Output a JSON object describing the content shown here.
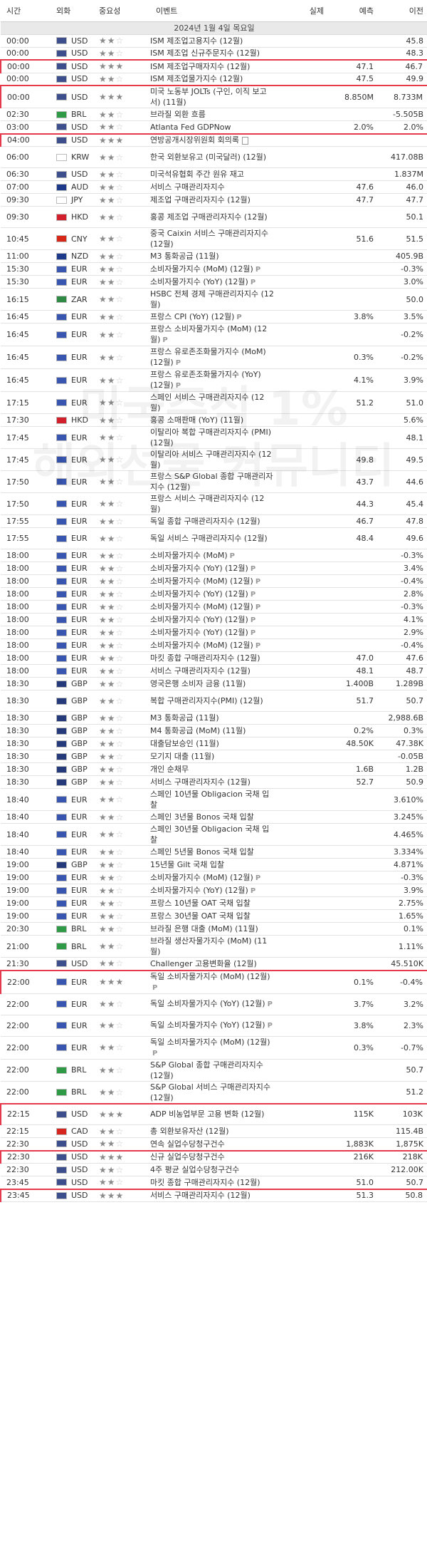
{
  "header": {
    "time": "시간",
    "currency": "외화",
    "importance": "중요성",
    "event": "이벤트",
    "actual": "실제",
    "forecast": "예측",
    "previous": "이전"
  },
  "date_label": "2024년 1월 4일 목요일",
  "watermark": [
    "미국주식 1%",
    "해외선물 커뮤니티"
  ],
  "colors": {
    "highlight_border": "#e53a4b",
    "date_bg": "#e9e9e9",
    "star_on": "#8a8a8a",
    "star_off": "#c8c8c8"
  },
  "icons": {
    "preliminary": "P",
    "speech": "document-icon",
    "importance": "star-icon"
  },
  "flag_colors": {
    "USD": "#3c4f8c",
    "BRL": "#2f9a45",
    "KRW": "#ffffff",
    "AUD": "#1d3a8a",
    "JPY": "#ffffff",
    "HKD": "#d21f2c",
    "CNY": "#d62718",
    "NZD": "#1d3a8a",
    "EUR": "#3856b0",
    "ZAR": "#2f8a45",
    "GBP": "#243a7a",
    "CAD": "#d6241e"
  },
  "events": [
    {
      "time": "00:00",
      "cur": "USD",
      "imp": 2,
      "name": "ISM 제조업고용지수 (12월)",
      "act": "",
      "fc": "",
      "prev": "45.8",
      "h": 18
    },
    {
      "time": "00:00",
      "cur": "USD",
      "imp": 2,
      "name": "ISM 제조업 신규주문지수 (12월)",
      "act": "",
      "fc": "",
      "prev": "48.3",
      "h": 18
    },
    {
      "time": "00:00",
      "cur": "USD",
      "imp": 3,
      "name": "ISM 제조업구매자지수 (12월)",
      "act": "",
      "fc": "47.1",
      "prev": "46.7",
      "h": 18,
      "hl": 1
    },
    {
      "time": "00:00",
      "cur": "USD",
      "imp": 2,
      "name": "ISM 제조업물가지수 (12월)",
      "act": "",
      "fc": "47.5",
      "prev": "49.9",
      "h": 18
    },
    {
      "time": "00:00",
      "cur": "USD",
      "imp": 3,
      "name": "미국 노동부 JOLTs (구인, 이직 보고서) (11월)",
      "act": "",
      "fc": "8.850M",
      "prev": "8.733M",
      "h": 30,
      "hl": 1
    },
    {
      "time": "02:30",
      "cur": "BRL",
      "imp": 2,
      "name": "브라질 외환 흐름",
      "act": "",
      "fc": "",
      "prev": "-5.505B",
      "h": 18
    },
    {
      "time": "03:00",
      "cur": "USD",
      "imp": 2,
      "name": "Atlanta Fed GDPNow",
      "act": "",
      "fc": "2.0%",
      "prev": "2.0%",
      "h": 18
    },
    {
      "time": "04:00",
      "cur": "USD",
      "imp": 3,
      "name": "연방공개시장위원회 회의록",
      "act": "",
      "fc": "",
      "prev": "",
      "h": 18,
      "hl": 1,
      "doc": 1
    },
    {
      "time": "06:00",
      "cur": "KRW",
      "imp": 2,
      "name": "한국 외환보유고 (미국달러) (12월)",
      "act": "",
      "fc": "",
      "prev": "417.08B",
      "h": 30
    },
    {
      "time": "06:30",
      "cur": "USD",
      "imp": 2,
      "name": "미국석유협회 주간 원유 재고",
      "act": "",
      "fc": "",
      "prev": "1.837M",
      "h": 18
    },
    {
      "time": "07:00",
      "cur": "AUD",
      "imp": 2,
      "name": "서비스 구매관리자지수",
      "act": "",
      "fc": "47.6",
      "prev": "46.0",
      "h": 18
    },
    {
      "time": "09:30",
      "cur": "JPY",
      "imp": 2,
      "name": "제조업 구매관리자지수 (12월)",
      "act": "",
      "fc": "47.7",
      "prev": "47.7",
      "h": 18
    },
    {
      "time": "09:30",
      "cur": "HKD",
      "imp": 2,
      "name": "홍콩 제조업 구매관리자지수 (12월)",
      "act": "",
      "fc": "",
      "prev": "50.1",
      "h": 30
    },
    {
      "time": "10:45",
      "cur": "CNY",
      "imp": 2,
      "name": "중국 Caixin 서비스 구매관리자지수 (12월)",
      "act": "",
      "fc": "51.6",
      "prev": "51.5",
      "h": 30
    },
    {
      "time": "11:00",
      "cur": "NZD",
      "imp": 2,
      "name": "M3 통화공급 (11월)",
      "act": "",
      "fc": "",
      "prev": "405.9B",
      "h": 18
    },
    {
      "time": "15:30",
      "cur": "EUR",
      "imp": 2,
      "name": "소비자물가지수 (MoM) (12월)",
      "act": "",
      "fc": "",
      "prev": "-0.3%",
      "h": 18,
      "p": 1
    },
    {
      "time": "15:30",
      "cur": "EUR",
      "imp": 2,
      "name": "소비자물가지수 (YoY) (12월)",
      "act": "",
      "fc": "",
      "prev": "3.0%",
      "h": 18,
      "p": 1
    },
    {
      "time": "16:15",
      "cur": "ZAR",
      "imp": 2,
      "name": "HSBC 전체 경제 구매관리자지수 (12월)",
      "act": "",
      "fc": "",
      "prev": "50.0",
      "h": 30
    },
    {
      "time": "16:45",
      "cur": "EUR",
      "imp": 2,
      "name": "프랑스 CPI (YoY) (12월)",
      "act": "",
      "fc": "3.8%",
      "prev": "3.5%",
      "h": 18,
      "p": 1
    },
    {
      "time": "16:45",
      "cur": "EUR",
      "imp": 2,
      "name": "프랑스 소비자물가지수 (MoM) (12월)",
      "act": "",
      "fc": "",
      "prev": "-0.2%",
      "h": 30,
      "p": 1
    },
    {
      "time": "16:45",
      "cur": "EUR",
      "imp": 2,
      "name": "프랑스 유로존조화물가지수 (MoM) (12월)",
      "act": "",
      "fc": "0.3%",
      "prev": "-0.2%",
      "h": 30,
      "p": 1
    },
    {
      "time": "16:45",
      "cur": "EUR",
      "imp": 2,
      "name": "프랑스 유로존조화물가지수 (YoY) (12월)",
      "act": "",
      "fc": "4.1%",
      "prev": "3.9%",
      "h": 30,
      "p": 1
    },
    {
      "time": "17:15",
      "cur": "EUR",
      "imp": 2,
      "name": "스페인 서비스 구매관리자지수 (12월)",
      "act": "",
      "fc": "51.2",
      "prev": "51.0",
      "h": 30
    },
    {
      "time": "17:30",
      "cur": "HKD",
      "imp": 2,
      "name": "홍콩 소매판매 (YoY) (11월)",
      "act": "",
      "fc": "",
      "prev": "5.6%",
      "h": 18
    },
    {
      "time": "17:45",
      "cur": "EUR",
      "imp": 2,
      "name": "이탈리아 복합 구매관리자지수 (PMI) (12월)",
      "act": "",
      "fc": "",
      "prev": "48.1",
      "h": 30
    },
    {
      "time": "17:45",
      "cur": "EUR",
      "imp": 2,
      "name": "이탈리아 서비스 구매관리자지수 (12월)",
      "act": "",
      "fc": "49.8",
      "prev": "49.5",
      "h": 30
    },
    {
      "time": "17:50",
      "cur": "EUR",
      "imp": 2,
      "name": "프랑스 S&P Global 종합 구매관리자지수 (12월)",
      "act": "",
      "fc": "43.7",
      "prev": "44.6",
      "h": 30
    },
    {
      "time": "17:50",
      "cur": "EUR",
      "imp": 2,
      "name": "프랑스 서비스 구매관리자지수 (12월)",
      "act": "",
      "fc": "44.3",
      "prev": "45.4",
      "h": 30
    },
    {
      "time": "17:55",
      "cur": "EUR",
      "imp": 2,
      "name": "독일 종합 구매관리자지수 (12월)",
      "act": "",
      "fc": "46.7",
      "prev": "47.8",
      "h": 18
    },
    {
      "time": "17:55",
      "cur": "EUR",
      "imp": 2,
      "name": "독일 서비스 구매관리자지수 (12월)",
      "act": "",
      "fc": "48.4",
      "prev": "49.6",
      "h": 30
    },
    {
      "time": "18:00",
      "cur": "EUR",
      "imp": 2,
      "name": "소비자물가지수 (MoM)",
      "act": "",
      "fc": "",
      "prev": "-0.3%",
      "h": 18,
      "p": 1
    },
    {
      "time": "18:00",
      "cur": "EUR",
      "imp": 2,
      "name": "소비자물가지수 (YoY) (12월)",
      "act": "",
      "fc": "",
      "prev": "3.4%",
      "h": 18,
      "p": 1
    },
    {
      "time": "18:00",
      "cur": "EUR",
      "imp": 2,
      "name": "소비자물가지수 (MoM) (12월)",
      "act": "",
      "fc": "",
      "prev": "-0.4%",
      "h": 18,
      "p": 1
    },
    {
      "time": "18:00",
      "cur": "EUR",
      "imp": 2,
      "name": "소비자물가지수 (YoY) (12월)",
      "act": "",
      "fc": "",
      "prev": "2.8%",
      "h": 18,
      "p": 1
    },
    {
      "time": "18:00",
      "cur": "EUR",
      "imp": 2,
      "name": "소비자물가지수 (MoM) (12월)",
      "act": "",
      "fc": "",
      "prev": "-0.3%",
      "h": 18,
      "p": 1
    },
    {
      "time": "18:00",
      "cur": "EUR",
      "imp": 2,
      "name": "소비자물가지수 (YoY) (12월)",
      "act": "",
      "fc": "",
      "prev": "4.1%",
      "h": 18,
      "p": 1
    },
    {
      "time": "18:00",
      "cur": "EUR",
      "imp": 2,
      "name": "소비자물가지수 (YoY) (12월)",
      "act": "",
      "fc": "",
      "prev": "2.9%",
      "h": 18,
      "p": 1
    },
    {
      "time": "18:00",
      "cur": "EUR",
      "imp": 2,
      "name": "소비자물가지수 (MoM) (12월)",
      "act": "",
      "fc": "",
      "prev": "-0.4%",
      "h": 18,
      "p": 1
    },
    {
      "time": "18:00",
      "cur": "EUR",
      "imp": 2,
      "name": "마킷 종합 구매관리자지수 (12월)",
      "act": "",
      "fc": "47.0",
      "prev": "47.6",
      "h": 18
    },
    {
      "time": "18:00",
      "cur": "EUR",
      "imp": 2,
      "name": "서비스 구매관리자지수 (12월)",
      "act": "",
      "fc": "48.1",
      "prev": "48.7",
      "h": 18
    },
    {
      "time": "18:30",
      "cur": "GBP",
      "imp": 2,
      "name": "영국은행 소비자 금융 (11월)",
      "act": "",
      "fc": "1.400B",
      "prev": "1.289B",
      "h": 18
    },
    {
      "time": "18:30",
      "cur": "GBP",
      "imp": 2,
      "name": "복합 구매관리자지수(PMI) (12월)",
      "act": "",
      "fc": "51.7",
      "prev": "50.7",
      "h": 30
    },
    {
      "time": "18:30",
      "cur": "GBP",
      "imp": 2,
      "name": "M3 통화공급 (11월)",
      "act": "",
      "fc": "",
      "prev": "2,988.6B",
      "h": 18
    },
    {
      "time": "18:30",
      "cur": "GBP",
      "imp": 2,
      "name": "M4 통화공급 (MoM) (11월)",
      "act": "",
      "fc": "0.2%",
      "prev": "0.3%",
      "h": 18
    },
    {
      "time": "18:30",
      "cur": "GBP",
      "imp": 2,
      "name": "대출담보승인 (11월)",
      "act": "",
      "fc": "48.50K",
      "prev": "47.38K",
      "h": 18
    },
    {
      "time": "18:30",
      "cur": "GBP",
      "imp": 2,
      "name": "모기지 대출 (11월)",
      "act": "",
      "fc": "",
      "prev": "-0.05B",
      "h": 18
    },
    {
      "time": "18:30",
      "cur": "GBP",
      "imp": 2,
      "name": "개인 순채무",
      "act": "",
      "fc": "1.6B",
      "prev": "1.2B",
      "h": 18
    },
    {
      "time": "18:30",
      "cur": "GBP",
      "imp": 2,
      "name": "서비스 구매관리자지수 (12월)",
      "act": "",
      "fc": "52.7",
      "prev": "50.9",
      "h": 18
    },
    {
      "time": "18:40",
      "cur": "EUR",
      "imp": 2,
      "name": "스페인 10년물 Obligacion 국채 입찰",
      "act": "",
      "fc": "",
      "prev": "3.610%",
      "h": 30
    },
    {
      "time": "18:40",
      "cur": "EUR",
      "imp": 2,
      "name": "스페인 3년물 Bonos 국채 입찰",
      "act": "",
      "fc": "",
      "prev": "3.245%",
      "h": 18
    },
    {
      "time": "18:40",
      "cur": "EUR",
      "imp": 2,
      "name": "스페인 30년물 Obligacion 국채 입찰",
      "act": "",
      "fc": "",
      "prev": "4.465%",
      "h": 30
    },
    {
      "time": "18:40",
      "cur": "EUR",
      "imp": 2,
      "name": "스페인 5년물 Bonos 국채 입찰",
      "act": "",
      "fc": "",
      "prev": "3.334%",
      "h": 18
    },
    {
      "time": "19:00",
      "cur": "GBP",
      "imp": 2,
      "name": "15년물 Gilt 국채 입찰",
      "act": "",
      "fc": "",
      "prev": "4.871%",
      "h": 18
    },
    {
      "time": "19:00",
      "cur": "EUR",
      "imp": 2,
      "name": "소비자물가지수 (MoM) (12월)",
      "act": "",
      "fc": "",
      "prev": "-0.3%",
      "h": 18,
      "p": 1
    },
    {
      "time": "19:00",
      "cur": "EUR",
      "imp": 2,
      "name": "소비자물가지수 (YoY) (12월)",
      "act": "",
      "fc": "",
      "prev": "3.9%",
      "h": 18,
      "p": 1
    },
    {
      "time": "19:00",
      "cur": "EUR",
      "imp": 2,
      "name": "프랑스 10년물 OAT 국채 입찰",
      "act": "",
      "fc": "",
      "prev": "2.75%",
      "h": 18
    },
    {
      "time": "19:00",
      "cur": "EUR",
      "imp": 2,
      "name": "프랑스 30년물 OAT 국채 입찰",
      "act": "",
      "fc": "",
      "prev": "1.65%",
      "h": 18
    },
    {
      "time": "20:30",
      "cur": "BRL",
      "imp": 2,
      "name": "브라질 은행 대출 (MoM) (11월)",
      "act": "",
      "fc": "",
      "prev": "0.1%",
      "h": 18
    },
    {
      "time": "21:00",
      "cur": "BRL",
      "imp": 2,
      "name": "브라질 생산자물가지수 (MoM) (11월)",
      "act": "",
      "fc": "",
      "prev": "1.11%",
      "h": 30
    },
    {
      "time": "21:30",
      "cur": "USD",
      "imp": 2,
      "name": "Challenger 고용변화율 (12월)",
      "act": "",
      "fc": "",
      "prev": "45.510K",
      "h": 18
    },
    {
      "time": "22:00",
      "cur": "EUR",
      "imp": 3,
      "name": "독일 소비자물가지수 (MoM) (12월)",
      "act": "",
      "fc": "0.1%",
      "prev": "-0.4%",
      "h": 30,
      "hl": 1,
      "p": 1
    },
    {
      "time": "22:00",
      "cur": "EUR",
      "imp": 2,
      "name": "독일 소비자물가지수 (YoY) (12월)",
      "act": "",
      "fc": "3.7%",
      "prev": "3.2%",
      "h": 30,
      "p": 1
    },
    {
      "time": "22:00",
      "cur": "EUR",
      "imp": 2,
      "name": "독일 소비자물가지수 (YoY) (12월)",
      "act": "",
      "fc": "3.8%",
      "prev": "2.3%",
      "h": 30,
      "p": 1
    },
    {
      "time": "22:00",
      "cur": "EUR",
      "imp": 2,
      "name": "독일 소비자물가지수 (MoM) (12월)",
      "act": "",
      "fc": "0.3%",
      "prev": "-0.7%",
      "h": 30,
      "p": 1
    },
    {
      "time": "22:00",
      "cur": "BRL",
      "imp": 2,
      "name": "S&P Global 종합 구매관리자지수 (12월)",
      "act": "",
      "fc": "",
      "prev": "50.7",
      "h": 30
    },
    {
      "time": "22:00",
      "cur": "BRL",
      "imp": 2,
      "name": "S&P Global 서비스 구매관리자지수 (12월)",
      "act": "",
      "fc": "",
      "prev": "51.2",
      "h": 30
    },
    {
      "time": "22:15",
      "cur": "USD",
      "imp": 3,
      "name": "ADP 비농업부문 고용 변화 (12월)",
      "act": "",
      "fc": "115K",
      "prev": "103K",
      "h": 30,
      "hl": 1
    },
    {
      "time": "22:15",
      "cur": "CAD",
      "imp": 2,
      "name": "총 외환보유자산 (12월)",
      "act": "",
      "fc": "",
      "prev": "115.4B",
      "h": 18
    },
    {
      "time": "22:30",
      "cur": "USD",
      "imp": 2,
      "name": "연속 실업수당청구건수",
      "act": "",
      "fc": "1,883K",
      "prev": "1,875K",
      "h": 18
    },
    {
      "time": "22:30",
      "cur": "USD",
      "imp": 3,
      "name": "신규 실업수당청구건수",
      "act": "",
      "fc": "216K",
      "prev": "218K",
      "h": 18,
      "hl": 1
    },
    {
      "time": "22:30",
      "cur": "USD",
      "imp": 2,
      "name": "4주 평균 실업수당청구건수",
      "act": "",
      "fc": "",
      "prev": "212.00K",
      "h": 18
    },
    {
      "time": "23:45",
      "cur": "USD",
      "imp": 2,
      "name": "마킷 종합 구매관리자지수 (12월)",
      "act": "",
      "fc": "51.0",
      "prev": "50.7",
      "h": 18
    },
    {
      "time": "23:45",
      "cur": "USD",
      "imp": 3,
      "name": "서비스 구매관리자지수 (12월)",
      "act": "",
      "fc": "51.3",
      "prev": "50.8",
      "h": 18,
      "hl": 1
    }
  ]
}
